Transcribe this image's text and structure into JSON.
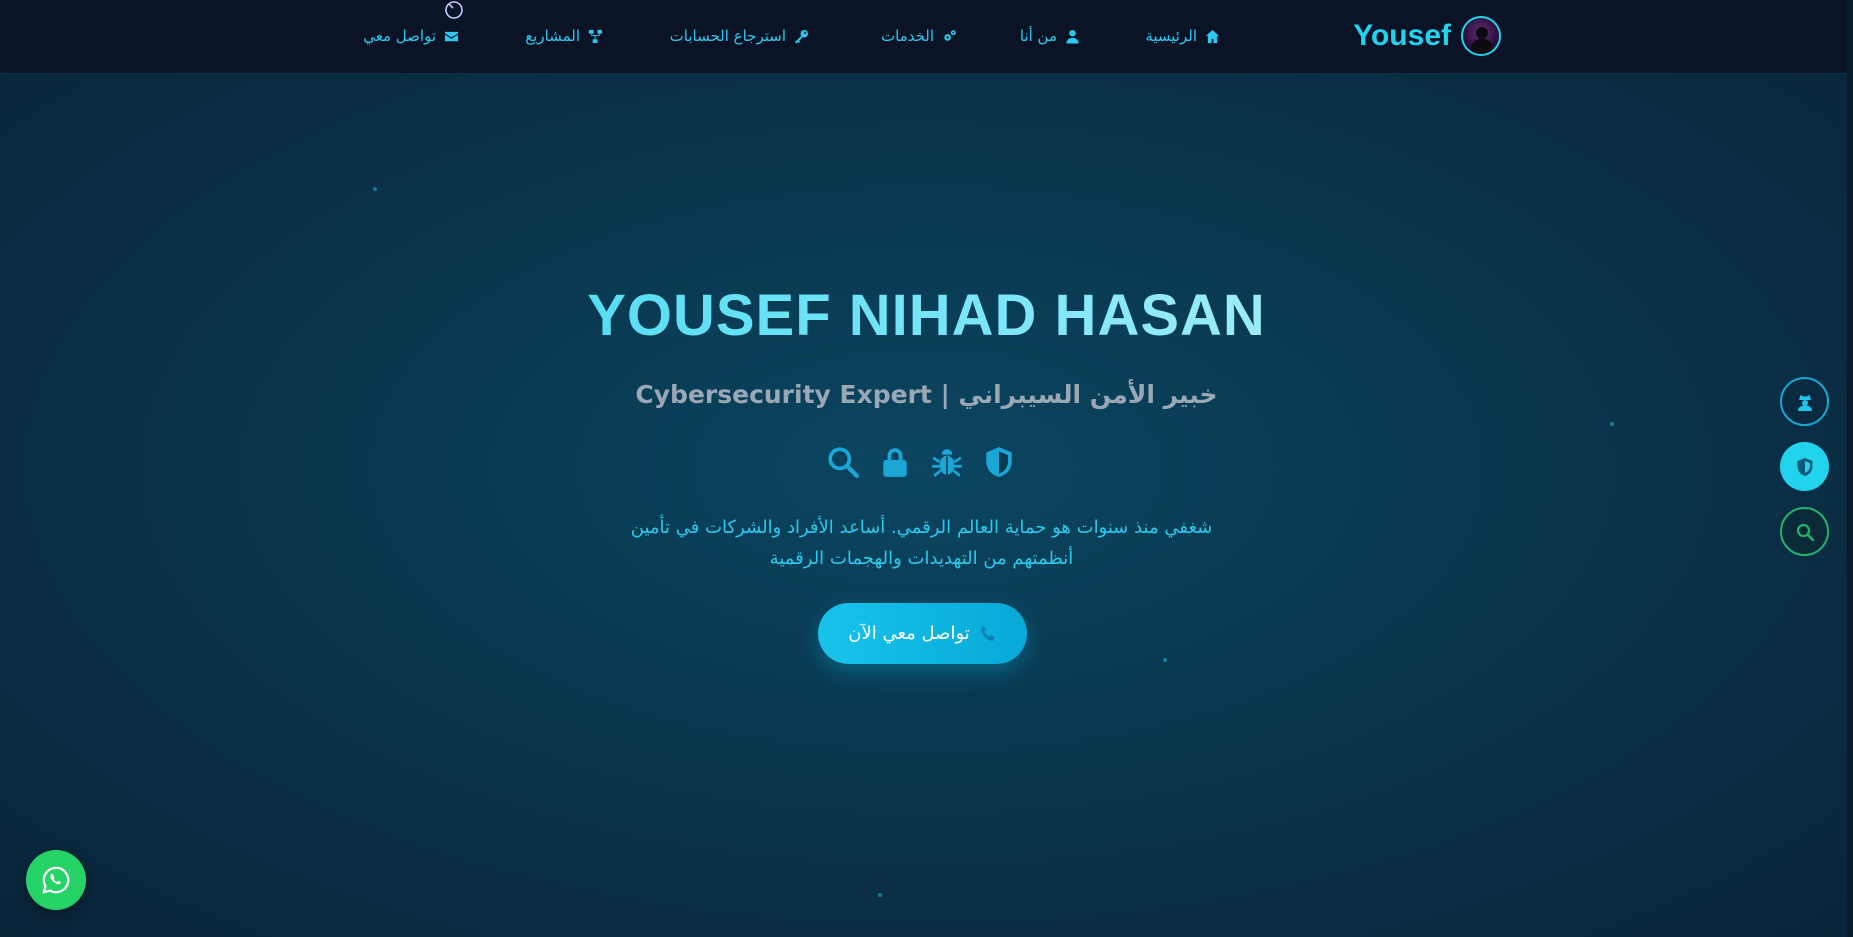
{
  "nav": {
    "brand": "Yousef",
    "items": [
      {
        "label": "الرئيسية",
        "icon": "home-icon"
      },
      {
        "label": "من أنا",
        "icon": "user-icon"
      },
      {
        "label": "الخدمات",
        "icon": "gears-icon"
      },
      {
        "label": "استرجاع الحسابات",
        "icon": "key-icon"
      },
      {
        "label": "المشاريع",
        "icon": "project-diagram-icon"
      },
      {
        "label": "تواصل معي",
        "icon": "envelope-icon"
      }
    ]
  },
  "hero": {
    "title": "YOUSEF NIHAD HASAN",
    "subtitle": "خبير الأمن السيبراني | Cybersecurity Expert",
    "icons": [
      "search-icon",
      "lock-icon",
      "bug-icon",
      "shield-icon"
    ],
    "description_line1": "شغفي منذ سنوات هو حماية العالم الرقمي. أساعد الأفراد والشركات في تأمين",
    "description_line2": "أنظمتهم من التهديدات والهجمات الرقمية",
    "cta_label": "تواصل معي الآن"
  },
  "side_buttons": [
    "user-secret-icon",
    "shield-icon",
    "search-icon"
  ],
  "floating": {
    "whatsapp": "whatsapp-icon"
  },
  "colors": {
    "accent": "#22d3ee",
    "nav_bg": "#0b1326",
    "whatsapp": "#25d366"
  }
}
